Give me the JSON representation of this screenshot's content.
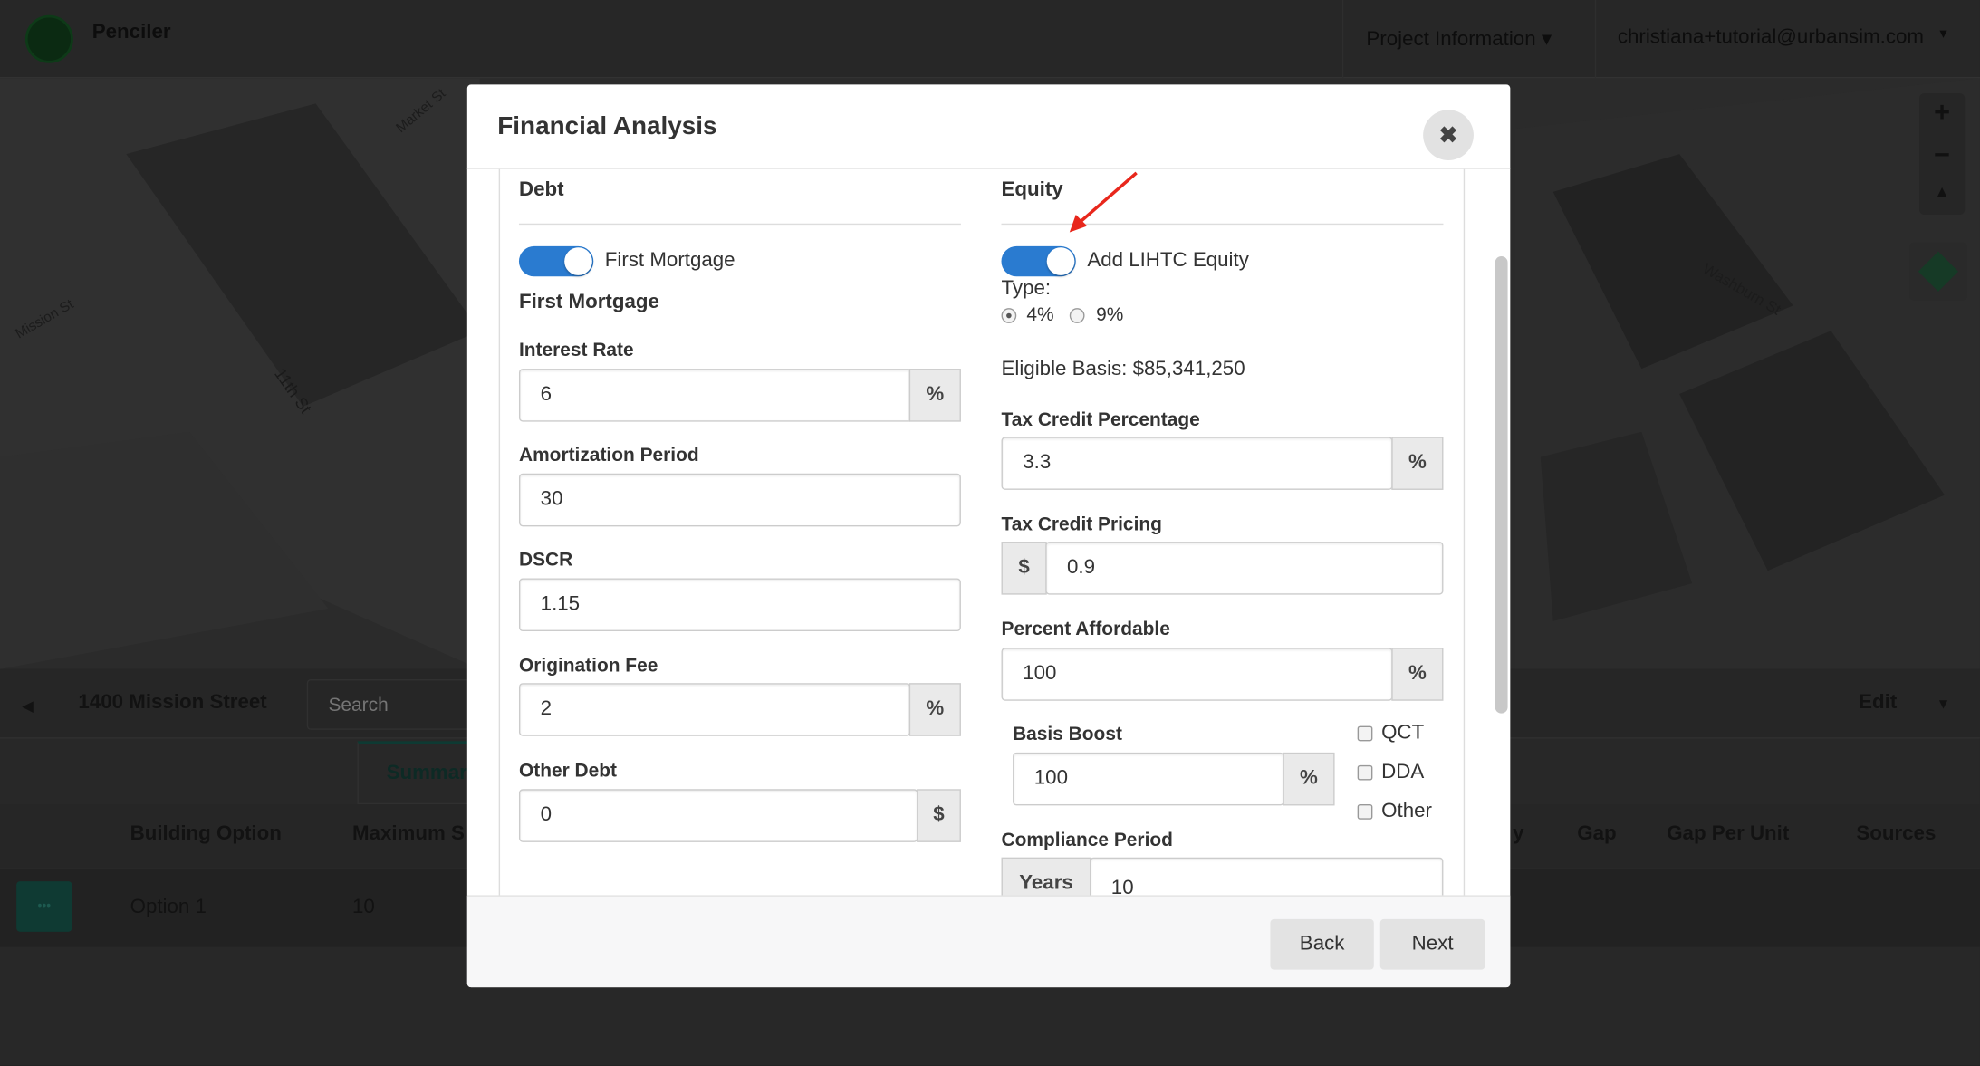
{
  "navbar": {
    "brand": "Penciler",
    "project_menu": "Project Information ▾",
    "user_menu": "christiana+tutorial@urbansim.com",
    "user_caret": "▾"
  },
  "map": {
    "labels": [
      "Mission St",
      "11th St",
      "Washburn St",
      "Market St"
    ],
    "zoom_in": "+",
    "zoom_out": "−",
    "compass": "▲"
  },
  "bottom_panel": {
    "back_arrow": "◂",
    "project_name": "1400 Mission Street",
    "search_placeholder": "Search",
    "edit_label": "Edit",
    "edit_caret": "▾",
    "tab_summary": "Summary",
    "columns": [
      "Building Option",
      "Maximum S",
      "y",
      "Gap",
      "Gap Per Unit",
      "Sources"
    ],
    "rows": [
      {
        "menu": "•••",
        "option": "Option 1",
        "max": "10"
      }
    ]
  },
  "modal": {
    "title": "Financial Analysis",
    "close_icon": "✖",
    "debt": {
      "heading": "Debt",
      "toggle_label": "First Mortgage",
      "toggle_on": true,
      "subheading": "First Mortgage",
      "interest_rate": {
        "label": "Interest Rate",
        "value": "6",
        "unit": "%"
      },
      "amortization": {
        "label": "Amortization Period",
        "value": "30"
      },
      "dscr": {
        "label": "DSCR",
        "value": "1.15"
      },
      "origination_fee": {
        "label": "Origination Fee",
        "value": "2",
        "unit": "%"
      },
      "other_debt": {
        "label": "Other Debt",
        "value": "0",
        "unit": "$"
      }
    },
    "equity": {
      "heading": "Equity",
      "toggle_label": "Add LIHTC Equity",
      "toggle_on": true,
      "type_label": "Type:",
      "type_options": [
        {
          "label": "4%",
          "checked": true
        },
        {
          "label": "9%",
          "checked": false
        }
      ],
      "eligible_basis": "Eligible Basis: $85,341,250",
      "tax_credit_percentage": {
        "label": "Tax Credit Percentage",
        "value": "3.3",
        "unit": "%"
      },
      "tax_credit_pricing": {
        "label": "Tax Credit Pricing",
        "prefix": "$",
        "value": "0.9"
      },
      "percent_affordable": {
        "label": "Percent Affordable",
        "value": "100",
        "unit": "%"
      },
      "basis_boost": {
        "label": "Basis Boost",
        "value": "100",
        "unit": "%"
      },
      "boost_checkboxes": [
        {
          "label": "QCT",
          "checked": false
        },
        {
          "label": "DDA",
          "checked": false
        },
        {
          "label": "Other",
          "checked": false
        }
      ],
      "compliance_period": {
        "label": "Compliance Period",
        "prefix": "Years",
        "value": "10"
      }
    },
    "footer": {
      "back": "Back",
      "next": "Next"
    }
  },
  "colors": {
    "toggle_on": "#2a7bd0",
    "annotation_arrow": "#e8271c",
    "teal": "#0f3a33"
  }
}
